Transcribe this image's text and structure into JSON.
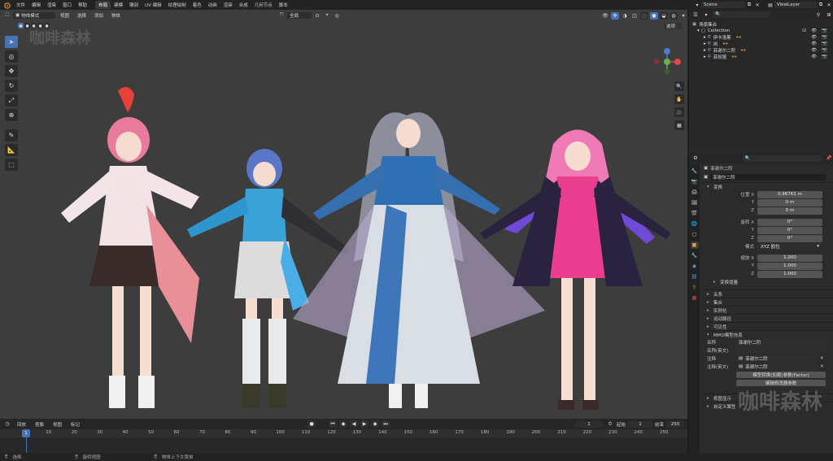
{
  "topbar": {
    "menus": [
      "文件",
      "编辑",
      "渲染",
      "窗口",
      "帮助"
    ],
    "workspaces": [
      {
        "label": "布局",
        "active": true
      },
      {
        "label": "建模",
        "active": false
      },
      {
        "label": "雕刻",
        "active": false
      },
      {
        "label": "UV 编辑",
        "active": false
      },
      {
        "label": "纹理绘制",
        "active": false
      },
      {
        "label": "着色",
        "active": false
      },
      {
        "label": "动画",
        "active": false
      },
      {
        "label": "渲染",
        "active": false
      },
      {
        "label": "合成",
        "active": false
      },
      {
        "label": "几何节点",
        "active": false
      },
      {
        "label": "脚本",
        "active": false
      }
    ],
    "scene": "Scene",
    "view_layer": "ViewLayer"
  },
  "viewport": {
    "mode": "物体模式",
    "menus": [
      "视图",
      "选择",
      "添加",
      "物体"
    ],
    "transform_orientation": "全局",
    "options_label": "选项",
    "watermark": "咖啡森林"
  },
  "outliner": {
    "root": "场景集合",
    "collection": "Collection",
    "items": [
      "伊卡洛斯",
      "岚",
      "菲谢尔二阶",
      "菲奴娅"
    ]
  },
  "properties": {
    "object_name": "菲谢尔二阶",
    "object_name_field": "菲谢尔二阶",
    "transform_header": "变换",
    "location_label": "位置 X",
    "location": [
      "0.96761 m",
      "0 m",
      "0 m"
    ],
    "rotation_label": "旋转 X",
    "rotation": [
      "0°",
      "0°",
      "0°"
    ],
    "mode_label": "模式",
    "mode_value": "XYZ 欧拉",
    "scale_label": "缩放 X",
    "scale": [
      "1.000",
      "1.000",
      "1.000"
    ],
    "y_label": "Y",
    "z_label": "Z",
    "delta_transform": "变换增量",
    "panels": [
      "关系",
      "集合",
      "实例化",
      "运动路径",
      "可见性"
    ],
    "mmd_header": "MMD模型信息",
    "mmd_name_label": "名称",
    "mmd_name": "菲谢尔二阶",
    "mmd_name_en_label": "名称(英文)",
    "mmd_field_a_label": "注释",
    "mmd_field_a": "菲谢尔二阶",
    "mmd_field_b_label": "注释(英文)",
    "mmd_field_b": "菲谢尔二阶",
    "mmd_button": "模型转换(加载)参数(Factor)",
    "mmd_button2": "编辑修改器参数",
    "panels_bottom": [
      "视图显示",
      "自定义属性"
    ],
    "watermark": "咖啡森林"
  },
  "timeline": {
    "menus": [
      "回放",
      "抠像",
      "视图",
      "标记"
    ],
    "current_frame": "1",
    "start_label": "起始",
    "start": "1",
    "end_label": "结束",
    "end": "250",
    "ticks": [
      1,
      10,
      20,
      30,
      40,
      50,
      60,
      70,
      80,
      90,
      100,
      110,
      120,
      130,
      140,
      150,
      160,
      170,
      180,
      190,
      200,
      210,
      220,
      230,
      240,
      250
    ]
  },
  "statusbar": {
    "items": [
      "选择",
      "旋转视图",
      "物体上下文菜单"
    ]
  },
  "colors": {
    "accent": "#4772b3",
    "viewport_bg": "#3d3d3d",
    "axis_x": "#d94a4a",
    "axis_y": "#6ab04c",
    "axis_z": "#4a78d9"
  }
}
